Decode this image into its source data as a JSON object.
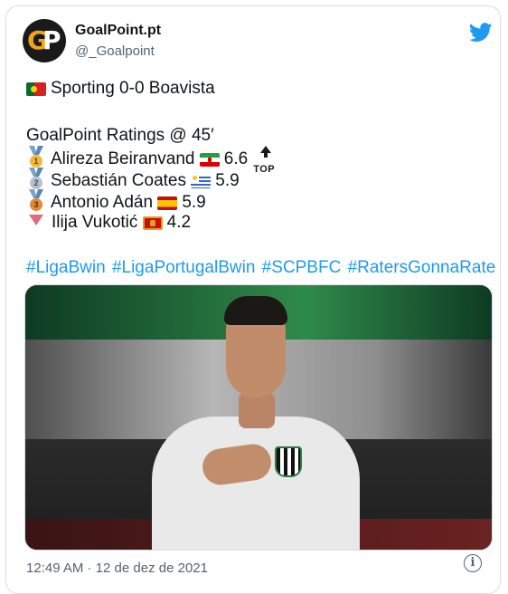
{
  "account": {
    "name": "GoalPoint.pt",
    "handle": "@_Goalpoint",
    "avatar_text_1": "G",
    "avatar_text_2": "P"
  },
  "tweet": {
    "match_line": "Sporting 0-0 Boavista",
    "ratings_title": "GoalPoint Ratings @ 45′",
    "ratings": [
      {
        "rank": "1",
        "player": "Alireza Beiranvand",
        "flag": "iran-flag-icon",
        "score": "6.6",
        "badge": "TOP"
      },
      {
        "rank": "2",
        "player": "Sebastián Coates",
        "flag": "uruguay-flag-icon",
        "score": "5.9"
      },
      {
        "rank": "3",
        "player": "Antonio Adán",
        "flag": "spain-flag-icon",
        "score": "5.9"
      },
      {
        "rank": "",
        "player": "Ilija Vukotić",
        "flag": "montenegro-flag-icon",
        "score": "4.2"
      }
    ],
    "hashtags": "#LigaBwin #LigaPortugalBwin #SCPBFC #RatersGonnaRate"
  },
  "timestamp": "12:49 AM · 12 de dez de 2021",
  "colors": {
    "link": "#1d9bf0",
    "text": "#0f1419",
    "muted": "#536471"
  }
}
